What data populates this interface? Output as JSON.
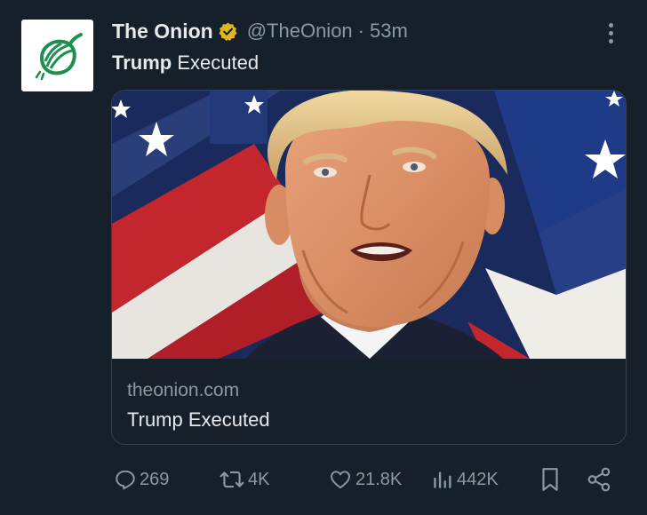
{
  "author": {
    "name": "The Onion",
    "handle": "@TheOnion",
    "separator": "·",
    "time": "53m",
    "verified_color": "#e2b719",
    "avatar_icon": "onion-logo-icon",
    "avatar_color": "#1e8f4e"
  },
  "tweet": {
    "text_bold": "Trump",
    "text_rest": " Executed"
  },
  "card": {
    "image_alt": "photo",
    "domain": "theonion.com",
    "title": "Trump Executed"
  },
  "actions": {
    "replies": "269",
    "retweets": "4K",
    "likes": "21.8K",
    "views": "442K"
  },
  "colors": {
    "background": "#15202b",
    "muted_text": "#8b98a5",
    "primary_text": "#e7e9ea",
    "border": "#38444d"
  }
}
